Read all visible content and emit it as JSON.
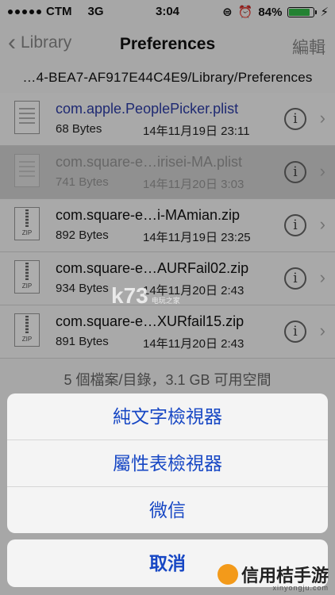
{
  "status": {
    "carrier": "CTM",
    "network": "3G",
    "time": "3:04",
    "battery": "84%"
  },
  "nav": {
    "back_label": "Library",
    "title": "Preferences",
    "edit_label": "編輯"
  },
  "path": "…4-BEA7-AF917E44C4E9/Library/Preferences",
  "files": [
    {
      "name": "com.apple.PeoplePicker.plist",
      "size": "68 Bytes",
      "date": "14年11月19日 23:11",
      "type": "plist"
    },
    {
      "name": "com.square-e…irisei-MA.plist",
      "size": "741 Bytes",
      "date": "14年11月20日 3:03",
      "type": "plist"
    },
    {
      "name": "com.square-e…i-MAmian.zip",
      "size": "892 Bytes",
      "date": "14年11月19日 23:25",
      "type": "zip"
    },
    {
      "name": "com.square-e…AURFail02.zip",
      "size": "934 Bytes",
      "date": "14年11月20日 2:43",
      "type": "zip"
    },
    {
      "name": "com.square-e…XURfail15.zip",
      "size": "891 Bytes",
      "date": "14年11月20日 2:43",
      "type": "zip"
    }
  ],
  "zip_label": "ZIP",
  "footer": "5 個檔案/目錄，3.1 GB 可用空間",
  "sheet": {
    "options": [
      "純文字檢視器",
      "屬性表檢視器",
      "微信"
    ],
    "cancel": "取消"
  },
  "watermarks": {
    "k73": "k73",
    "k73_sub": "电玩之家",
    "site": "信用桔手游",
    "site_url": "xinyongju.com"
  },
  "colors": {
    "accent": "#1747c4",
    "battery": "#34c04a"
  }
}
